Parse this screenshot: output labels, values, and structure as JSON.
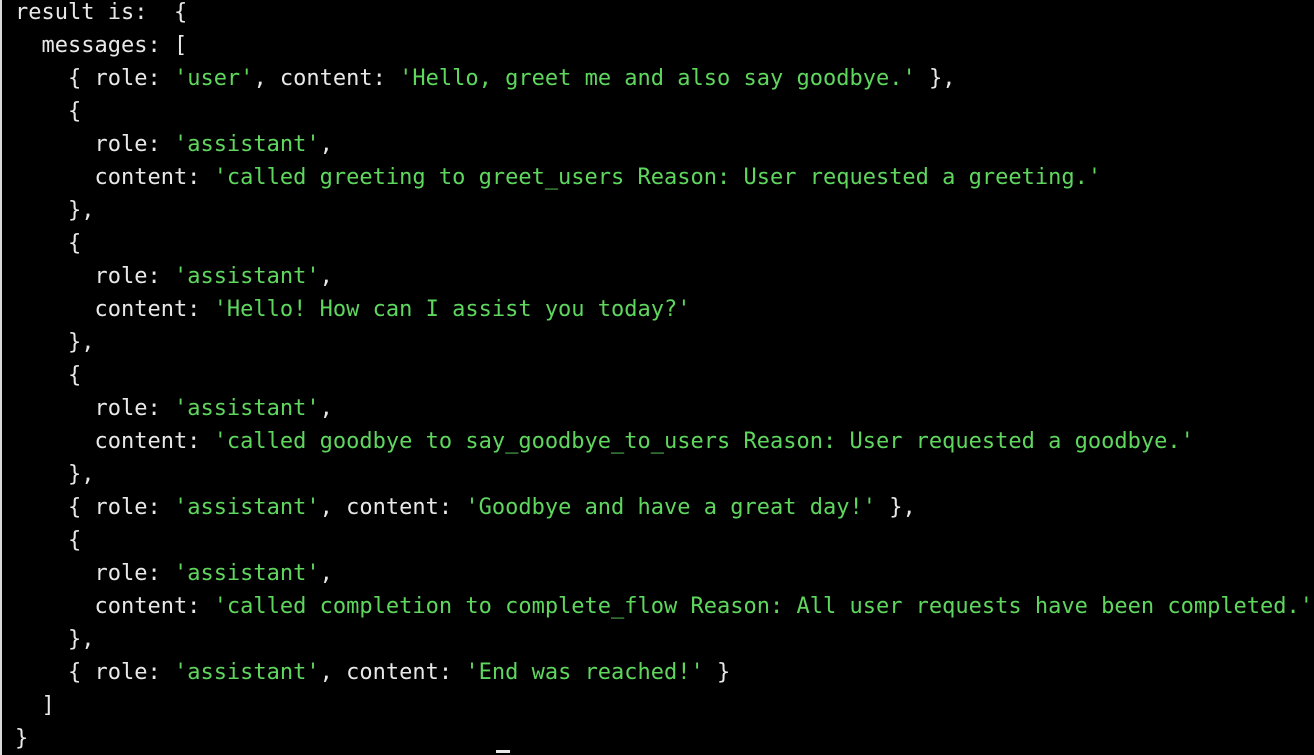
{
  "terminal": {
    "lines": [
      [
        {
          "t": "result is:  {",
          "c": "txt"
        }
      ],
      [
        {
          "t": "  messages: [",
          "c": "txt"
        }
      ],
      [
        {
          "t": "    { role: ",
          "c": "txt"
        },
        {
          "t": "'user'",
          "c": "str"
        },
        {
          "t": ", content: ",
          "c": "txt"
        },
        {
          "t": "'Hello, greet me and also say goodbye.'",
          "c": "str"
        },
        {
          "t": " },",
          "c": "txt"
        }
      ],
      [
        {
          "t": "    {",
          "c": "txt"
        }
      ],
      [
        {
          "t": "      role: ",
          "c": "txt"
        },
        {
          "t": "'assistant'",
          "c": "str"
        },
        {
          "t": ",",
          "c": "txt"
        }
      ],
      [
        {
          "t": "      content: ",
          "c": "txt"
        },
        {
          "t": "'called greeting to greet_users Reason: User requested a greeting.'",
          "c": "str"
        }
      ],
      [
        {
          "t": "    },",
          "c": "txt"
        }
      ],
      [
        {
          "t": "    {",
          "c": "txt"
        }
      ],
      [
        {
          "t": "      role: ",
          "c": "txt"
        },
        {
          "t": "'assistant'",
          "c": "str"
        },
        {
          "t": ",",
          "c": "txt"
        }
      ],
      [
        {
          "t": "      content: ",
          "c": "txt"
        },
        {
          "t": "'Hello! How can I assist you today?'",
          "c": "str"
        }
      ],
      [
        {
          "t": "    },",
          "c": "txt"
        }
      ],
      [
        {
          "t": "    {",
          "c": "txt"
        }
      ],
      [
        {
          "t": "      role: ",
          "c": "txt"
        },
        {
          "t": "'assistant'",
          "c": "str"
        },
        {
          "t": ",",
          "c": "txt"
        }
      ],
      [
        {
          "t": "      content: ",
          "c": "txt"
        },
        {
          "t": "'called goodbye to say_goodbye_to_users Reason: User requested a goodbye.'",
          "c": "str"
        }
      ],
      [
        {
          "t": "    },",
          "c": "txt"
        }
      ],
      [
        {
          "t": "    { role: ",
          "c": "txt"
        },
        {
          "t": "'assistant'",
          "c": "str"
        },
        {
          "t": ", content: ",
          "c": "txt"
        },
        {
          "t": "'Goodbye and have a great day!'",
          "c": "str"
        },
        {
          "t": " },",
          "c": "txt"
        }
      ],
      [
        {
          "t": "    {",
          "c": "txt"
        }
      ],
      [
        {
          "t": "      role: ",
          "c": "txt"
        },
        {
          "t": "'assistant'",
          "c": "str"
        },
        {
          "t": ",",
          "c": "txt"
        }
      ],
      [
        {
          "t": "      content: ",
          "c": "txt"
        },
        {
          "t": "'called completion to complete_flow Reason: All user requests have been completed.'",
          "c": "str"
        }
      ],
      [
        {
          "t": "    },",
          "c": "txt"
        }
      ],
      [
        {
          "t": "    { role: ",
          "c": "txt"
        },
        {
          "t": "'assistant'",
          "c": "str"
        },
        {
          "t": ", content: ",
          "c": "txt"
        },
        {
          "t": "'End was reached!'",
          "c": "str"
        },
        {
          "t": " }",
          "c": "txt"
        }
      ],
      [
        {
          "t": "  ]",
          "c": "txt"
        }
      ],
      [
        {
          "t": "}",
          "c": "txt"
        }
      ]
    ]
  },
  "colors": {
    "background": "#000000",
    "text": "#e8e8e8",
    "string": "#5fd75f"
  }
}
